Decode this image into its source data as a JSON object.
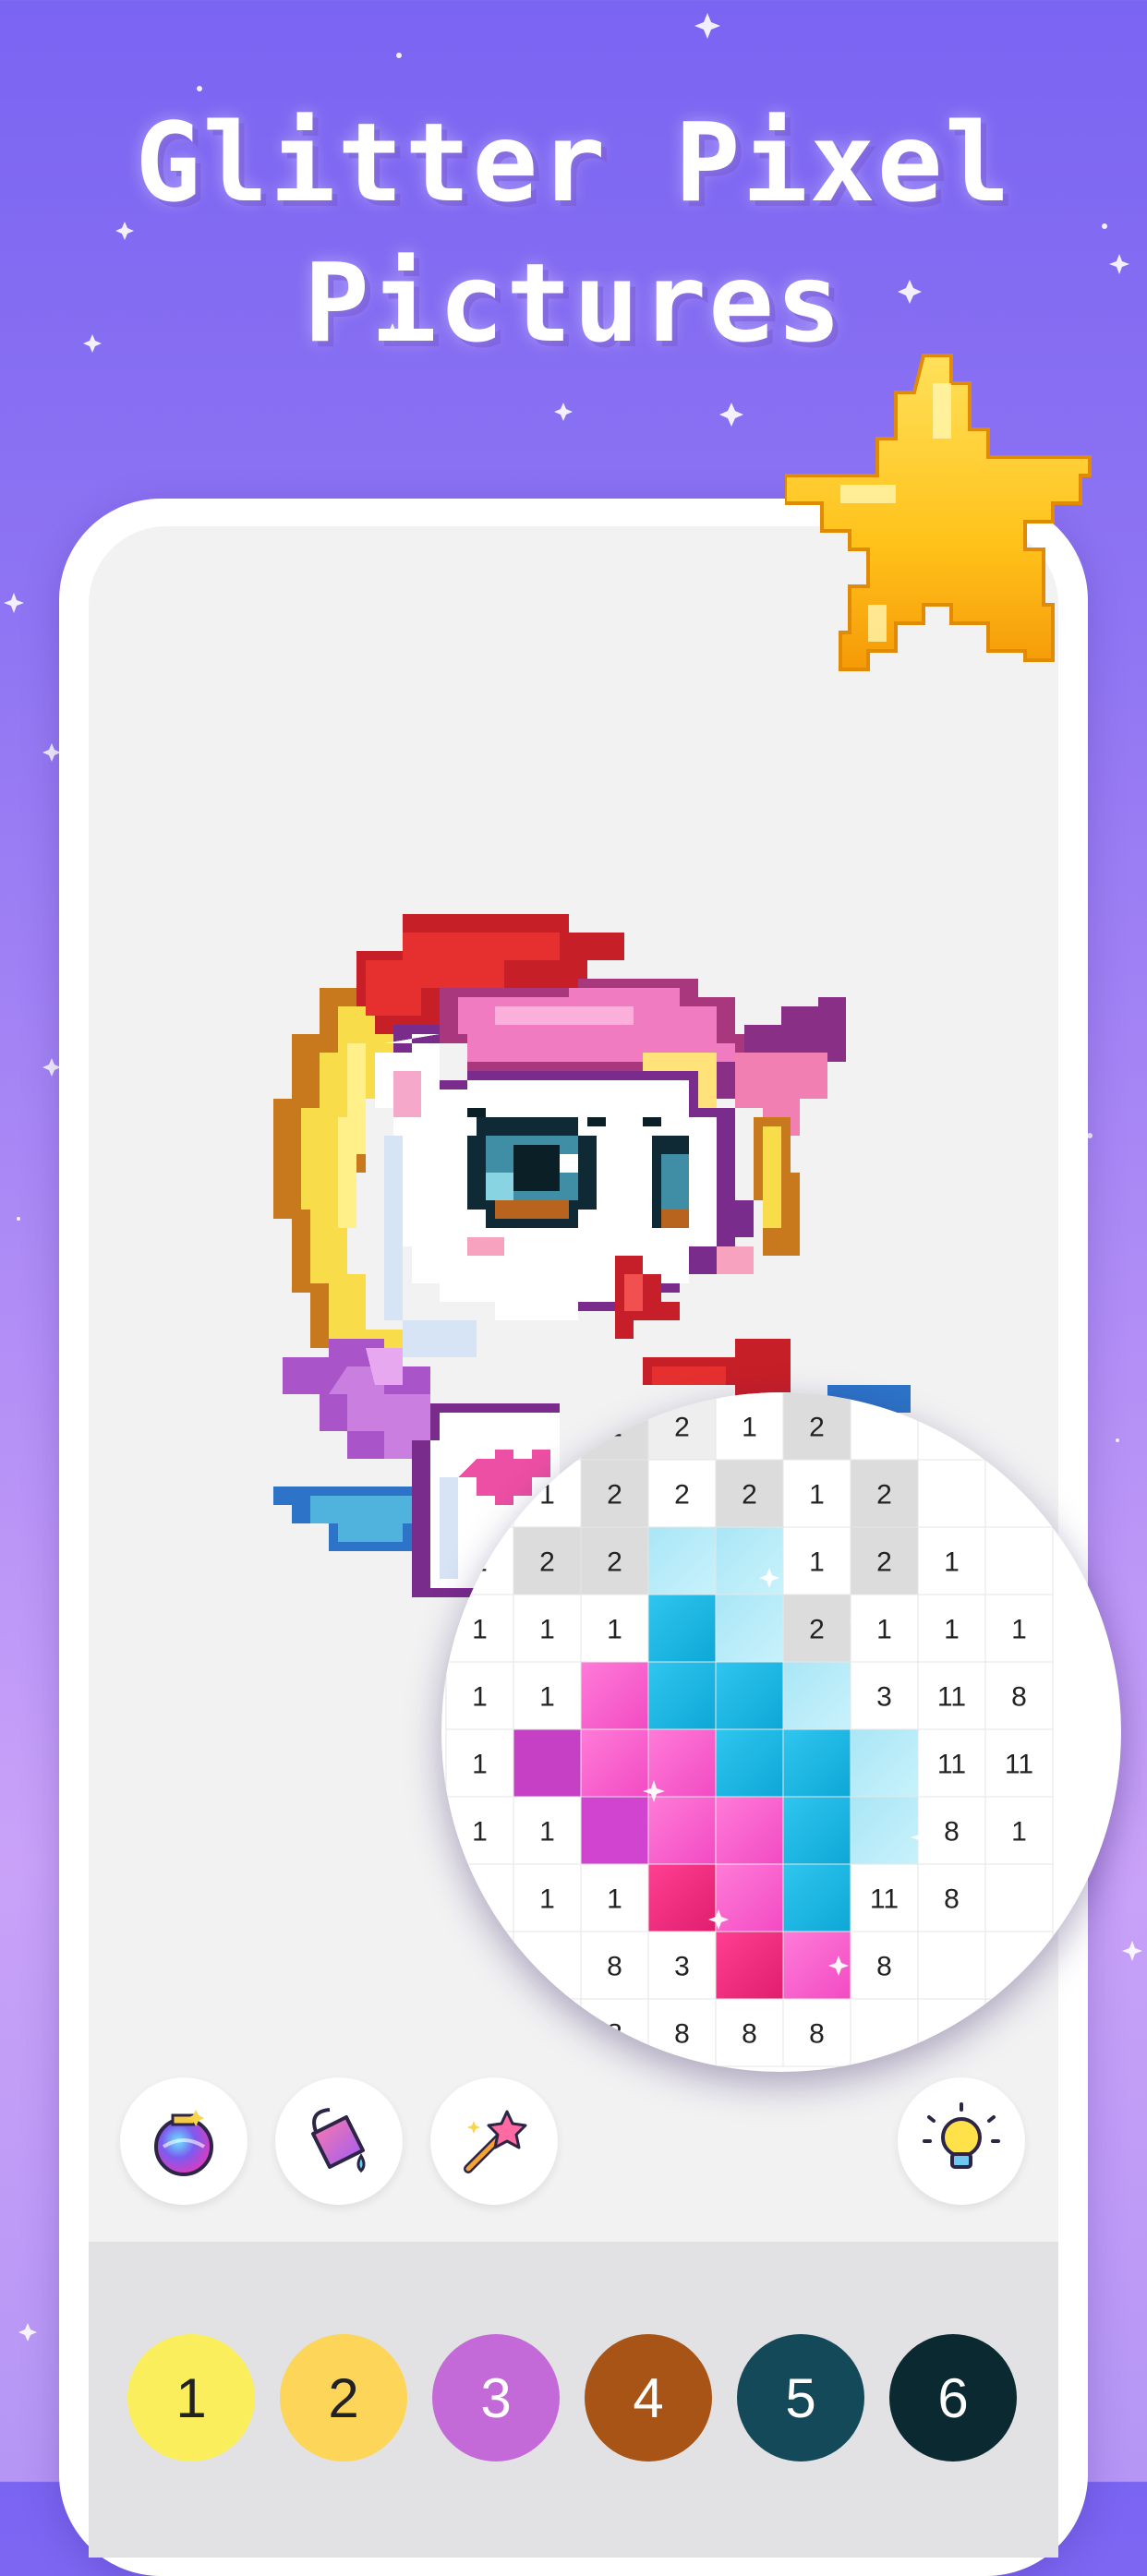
{
  "headline": {
    "line1": "Glitter Pixel",
    "line2": "Pictures"
  },
  "tools": [
    {
      "name": "glitter-bomb",
      "icon": "glitter-potion-icon"
    },
    {
      "name": "paint-bucket",
      "icon": "paint-bucket-icon"
    },
    {
      "name": "magic-wand",
      "icon": "magic-wand-icon"
    },
    {
      "name": "hint",
      "icon": "lightbulb-icon"
    }
  ],
  "palette": [
    {
      "label": "1",
      "color": "#fbee5c",
      "text_color": "#222222"
    },
    {
      "label": "2",
      "color": "#fcd559",
      "text_color": "#222222"
    },
    {
      "label": "3",
      "color": "#c46ad8",
      "text_color": "#ffffff"
    },
    {
      "label": "4",
      "color": "#a85416",
      "text_color": "#ffffff"
    },
    {
      "label": "5",
      "color": "#14495a",
      "text_color": "#ffffff"
    },
    {
      "label": "6",
      "color": "#0b2930",
      "text_color": "#ffffff"
    }
  ],
  "magnifier_grid": [
    [
      "",
      "",
      "2",
      "2",
      "1",
      "2",
      "",
      "",
      ""
    ],
    [
      "",
      "1",
      "2",
      "2",
      "2",
      "1",
      "2",
      "",
      ""
    ],
    [
      "1",
      "2",
      "2",
      "",
      "",
      "1",
      "2",
      "1",
      ""
    ],
    [
      "1",
      "1",
      "1",
      "",
      "",
      "2",
      "1",
      "1",
      "1"
    ],
    [
      "1",
      "1",
      "",
      "",
      "",
      "",
      "3",
      "11",
      "8"
    ],
    [
      "1",
      "",
      "",
      "",
      "",
      "",
      "",
      "11",
      "11"
    ],
    [
      "1",
      "1",
      "",
      "",
      "",
      "",
      "",
      "8",
      "1"
    ],
    [
      "",
      "1",
      "1",
      "",
      "",
      "",
      "11",
      "8",
      ""
    ],
    [
      "",
      "",
      "8",
      "3",
      "",
      "",
      "8",
      "",
      ""
    ],
    [
      "",
      "",
      "8",
      "8",
      "8",
      "8",
      "",
      "",
      ""
    ]
  ]
}
